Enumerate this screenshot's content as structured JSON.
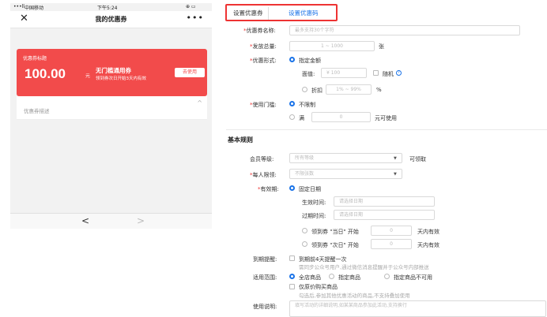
{
  "phone": {
    "status": {
      "carrier": "中国移动",
      "time": "下午5:24"
    },
    "nav": {
      "title": "我的优惠券",
      "close": "✕",
      "more": "•••"
    },
    "coupon": {
      "tag": "优惠券标题",
      "amount": "100.00",
      "unit": "元",
      "name": "无门槛通用券",
      "sub": "领到券次日开始3天内有效",
      "button": "去使用",
      "desc": "优惠券描述",
      "caret": "^"
    },
    "bottom": {
      "prev": "<",
      "next": ">"
    }
  },
  "tabs": {
    "tab1": "设置优惠券",
    "tab2": "设置优惠码"
  },
  "form": {
    "name": {
      "label": "优惠券名称:",
      "placeholder": "最多支持30个字符"
    },
    "total": {
      "label": "发放总量:",
      "placeholder": "1 ~ 1000",
      "unit": "张"
    },
    "type": {
      "label": "优惠形式:",
      "opt_fixed": "指定金额",
      "face_label": "面值:",
      "face_placeholder": "¥ 100",
      "random": "随机",
      "help": "?",
      "opt_discount": "折扣",
      "discount_placeholder": "1% ~ 99%",
      "percent": "%"
    },
    "threshold": {
      "label": "使用门槛:",
      "opt_none": "不限制",
      "full": "满",
      "value": "0",
      "suffix": "元可使用"
    }
  },
  "basic": {
    "title": "基本规则",
    "level": {
      "label": "会员等级:",
      "value": "所有等级",
      "suffix": "可领取"
    },
    "limit": {
      "label": "每人限领:",
      "value": "不限张数"
    },
    "validity": {
      "label": "有效期:",
      "fixed": "固定日期",
      "start_label": "生效时间:",
      "start_placeholder": "请选择日期",
      "end_label": "过期时间:",
      "end_placeholder": "请选择日期",
      "same_day_pre": "领到券 \"当日\" 开始",
      "same_day_value": "0",
      "same_day_post": "天内有效",
      "next_day_pre": "领到券 \"次日\" 开始",
      "next_day_value": "0",
      "next_day_post": "天内有效"
    },
    "remind": {
      "label": "到期提醒:",
      "line1": "到期前4天提醒一次",
      "line2": "需同步公众号用户,通过微信消息提醒并于公众号内部推送"
    },
    "scope": {
      "label": "适用范围:",
      "all": "全店商品",
      "specified": "指定商品",
      "excluded": "指定商品不可用",
      "original": "仅原价购买商品",
      "original_hint": "勾选后,参加其他优惠活动的商品,不支持叠加使用"
    },
    "instructions": {
      "label": "使用说明:",
      "placeholder": "填写活动的详细说明,如某某商品参加此活动,支持换行"
    }
  }
}
